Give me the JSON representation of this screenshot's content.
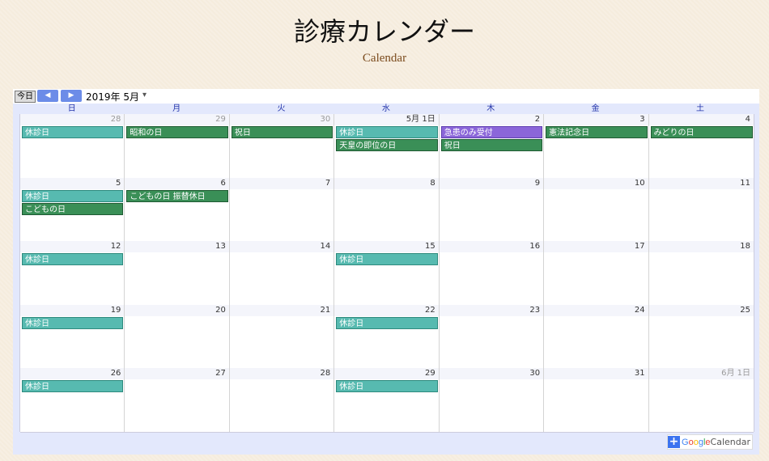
{
  "header": {
    "title": "診療カレンダー",
    "subtitle": "Calendar"
  },
  "toolbar": {
    "today_label": "今日",
    "prev_icon": "◀",
    "next_icon": "▶",
    "month_label": "2019年 5月",
    "dropdown_icon": "▾"
  },
  "weekdays": [
    "日",
    "月",
    "火",
    "水",
    "木",
    "金",
    "土"
  ],
  "weeks": [
    {
      "days": [
        {
          "num": "28",
          "other": true,
          "events": [
            {
              "title": "休診日",
              "color": "teal"
            }
          ]
        },
        {
          "num": "29",
          "other": true,
          "events": [
            {
              "title": "昭和の日",
              "color": "green"
            }
          ]
        },
        {
          "num": "30",
          "other": true,
          "events": [
            {
              "title": "祝日",
              "color": "green"
            }
          ]
        },
        {
          "num": "5月 1日",
          "other": false,
          "events": [
            {
              "title": "休診日",
              "color": "teal"
            },
            {
              "title": "天皇の即位の日",
              "color": "green"
            }
          ]
        },
        {
          "num": "2",
          "other": false,
          "events": [
            {
              "title": "急患のみ受付",
              "color": "purple"
            },
            {
              "title": "祝日",
              "color": "green"
            }
          ]
        },
        {
          "num": "3",
          "other": false,
          "events": [
            {
              "title": "憲法記念日",
              "color": "green"
            }
          ]
        },
        {
          "num": "4",
          "other": false,
          "events": [
            {
              "title": "みどりの日",
              "color": "green"
            }
          ]
        }
      ]
    },
    {
      "days": [
        {
          "num": "5",
          "other": false,
          "events": [
            {
              "title": "休診日",
              "color": "teal"
            },
            {
              "title": "こどもの日",
              "color": "green"
            }
          ]
        },
        {
          "num": "6",
          "other": false,
          "events": [
            {
              "title": "こどもの日 振替休日",
              "color": "green"
            }
          ]
        },
        {
          "num": "7",
          "other": false,
          "events": []
        },
        {
          "num": "8",
          "other": false,
          "events": []
        },
        {
          "num": "9",
          "other": false,
          "events": []
        },
        {
          "num": "10",
          "other": false,
          "events": []
        },
        {
          "num": "11",
          "other": false,
          "events": []
        }
      ]
    },
    {
      "days": [
        {
          "num": "12",
          "other": false,
          "events": [
            {
              "title": "休診日",
              "color": "teal"
            }
          ]
        },
        {
          "num": "13",
          "other": false,
          "events": []
        },
        {
          "num": "14",
          "other": false,
          "events": []
        },
        {
          "num": "15",
          "other": false,
          "events": [
            {
              "title": "休診日",
              "color": "teal"
            }
          ]
        },
        {
          "num": "16",
          "other": false,
          "events": []
        },
        {
          "num": "17",
          "other": false,
          "events": []
        },
        {
          "num": "18",
          "other": false,
          "events": []
        }
      ]
    },
    {
      "days": [
        {
          "num": "19",
          "other": false,
          "events": [
            {
              "title": "休診日",
              "color": "teal"
            }
          ]
        },
        {
          "num": "20",
          "other": false,
          "events": []
        },
        {
          "num": "21",
          "other": false,
          "events": []
        },
        {
          "num": "22",
          "other": false,
          "events": [
            {
              "title": "休診日",
              "color": "teal"
            }
          ]
        },
        {
          "num": "23",
          "other": false,
          "events": []
        },
        {
          "num": "24",
          "other": false,
          "events": []
        },
        {
          "num": "25",
          "other": false,
          "events": []
        }
      ]
    },
    {
      "days": [
        {
          "num": "26",
          "other": false,
          "events": [
            {
              "title": "休診日",
              "color": "teal"
            }
          ]
        },
        {
          "num": "27",
          "other": false,
          "events": []
        },
        {
          "num": "28",
          "other": false,
          "events": []
        },
        {
          "num": "29",
          "other": false,
          "events": [
            {
              "title": "休診日",
              "color": "teal"
            }
          ]
        },
        {
          "num": "30",
          "other": false,
          "events": []
        },
        {
          "num": "31",
          "other": false,
          "events": []
        },
        {
          "num": "6月 1日",
          "other": true,
          "events": []
        }
      ]
    }
  ],
  "colors": {
    "teal": "#57bab0",
    "green": "#3a8f57",
    "purple": "#8b66d9",
    "accent": "#6c8ce8"
  },
  "badge": {
    "plus_icon": "+",
    "google_letters": [
      "G",
      "o",
      "o",
      "g",
      "l",
      "e"
    ],
    "google_colors": [
      "#4285f4",
      "#ea4335",
      "#fbbc05",
      "#4285f4",
      "#34a853",
      "#ea4335"
    ],
    "calendar_label": "Calendar"
  }
}
